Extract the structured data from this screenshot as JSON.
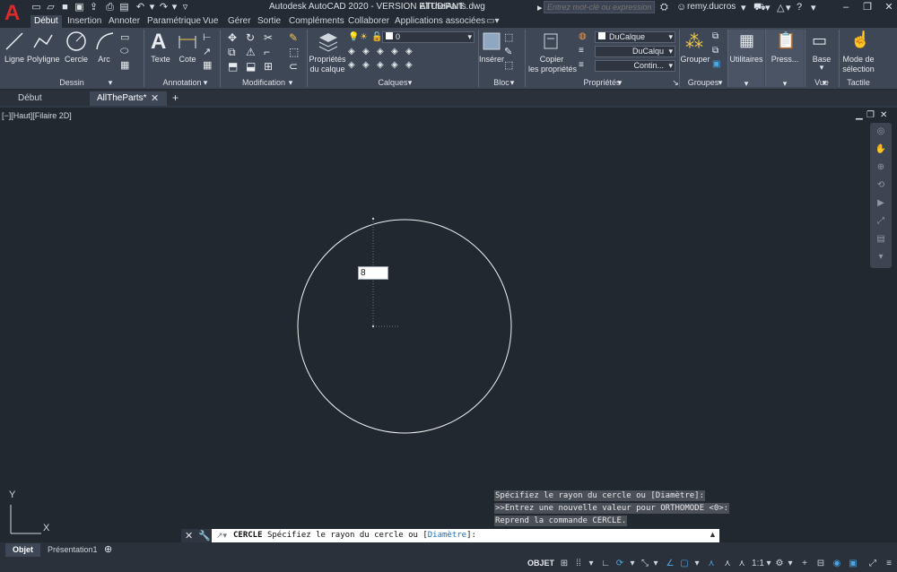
{
  "titlebar": {
    "app_letter": "A",
    "title": "Autodesk AutoCAD 2020 - VERSION ETUDIANT",
    "file": "AllTheParts.dwg",
    "search_placeholder": "Entrez mot-clé ou expression",
    "user": "remy.ducros",
    "help_icon": "?"
  },
  "ribbon_tabs": [
    "Début",
    "Insertion",
    "Annoter",
    "Paramétrique",
    "Vue",
    "Gérer",
    "Sortie",
    "Compléments",
    "Collaborer",
    "Applications associées"
  ],
  "ribbon": {
    "dessin": {
      "title": "Dessin",
      "ligne": "Ligne",
      "polyligne": "Polyligne",
      "cercle": "Cercle",
      "arc": "Arc"
    },
    "annotation": {
      "title": "Annotation",
      "texte": "Texte",
      "cote": "Cote"
    },
    "modification": {
      "title": "Modification"
    },
    "calques": {
      "title": "Calques",
      "proprietes": "Propriétés",
      "du_calque": "du calque",
      "layer_value": "0"
    },
    "bloc": {
      "title": "Bloc",
      "inserer": "Insérer"
    },
    "proprietes": {
      "title": "Propriétés",
      "copier": "Copier",
      "les_proprietes": "les propriétés",
      "color": "DuCalque",
      "linetype": "DuCalqu",
      "lineweight": "Contin..."
    },
    "groupes": {
      "title": "Groupes",
      "grouper": "Grouper"
    },
    "utilitaires": {
      "label": "Utilitaires"
    },
    "presse": {
      "label": "Press..."
    },
    "vue": {
      "title": "Vue",
      "base": "Base"
    },
    "tactile": {
      "title": "Tactile",
      "mode": "Mode de",
      "selection": "sélection"
    }
  },
  "doc_tabs": {
    "start": "Début",
    "current": "AllTheParts*"
  },
  "viewport": {
    "label": "[−][Haut][Filaire 2D]",
    "dyn_input": "8",
    "ucs_x": "X",
    "ucs_y": "Y"
  },
  "command_history": [
    "Spécifiez le rayon du cercle ou [Diamètre]:",
    ">>Entrez une nouvelle valeur pour ORTHOMODE <0>:",
    "Reprend la commande CERCLE."
  ],
  "command_line": {
    "cmd": "CERCLE",
    "prompt": "Spécifiez le rayon du cercle ou [",
    "option": "Diamètre",
    "end": "]:"
  },
  "layout_tabs": [
    "Objet",
    "Présentation1"
  ],
  "statusbar": {
    "mode": "OBJET",
    "scale": "1:1"
  },
  "colors": {
    "canvas": "#212830",
    "ribbon": "#3e4756",
    "accent": "#4aa6e6",
    "logo": "#d92b2b"
  }
}
